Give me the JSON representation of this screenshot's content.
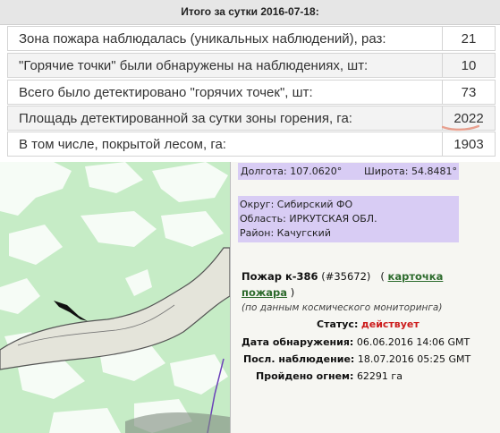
{
  "summary": {
    "header": "Итого за сутки 2016-07-18:",
    "rows": [
      {
        "label": "Зона пожара наблюдалась (уникальных наблюдений), раз:",
        "value": "21"
      },
      {
        "label": "\"Горячие точки\" были обнаружены на наблюдениях, шт:",
        "value": "10"
      },
      {
        "label": "Всего было детектировано \"горячих точек\", шт:",
        "value": "73"
      },
      {
        "label": "Площадь детектированной за сутки зоны горения, га:",
        "value": "2022"
      },
      {
        "label": "В том числе, покрытой лесом, га:",
        "value": "1903"
      }
    ],
    "highlight_color": "#e8a08f"
  },
  "popup": {
    "longitude": "Долгота: 107.0620°",
    "latitude": "Широта: 54.8481°",
    "district": "Округ: Сибирский ФО",
    "oblast": "Область: ИРКУТСКАЯ ОБЛ.",
    "raion": "Район: Качугский",
    "fire_label": "Пожар к-386",
    "fire_id": "(#35672)",
    "open_paren": "(",
    "card_link_1": "карточка",
    "card_link_2": "пожара",
    "close_paren": ")",
    "note": "(по данным космического мониторинга)",
    "status_key": "Статус:",
    "status_value": "действует",
    "detected_key": "Дата обнаружения:",
    "detected_value": "06.06.2016 14:06 GMT",
    "last_obs_key": "Посл. наблюдение:",
    "last_obs_value": "18.07.2016 05:25 GMT",
    "burned_key": "Пройдено огнем:",
    "burned_value": "62291 га",
    "highlight_color": "#d8ccf4"
  },
  "map": {
    "forest_color": "#c6ecc6",
    "clearing_color": "#ffffff",
    "river_color": "#e4e4da"
  }
}
